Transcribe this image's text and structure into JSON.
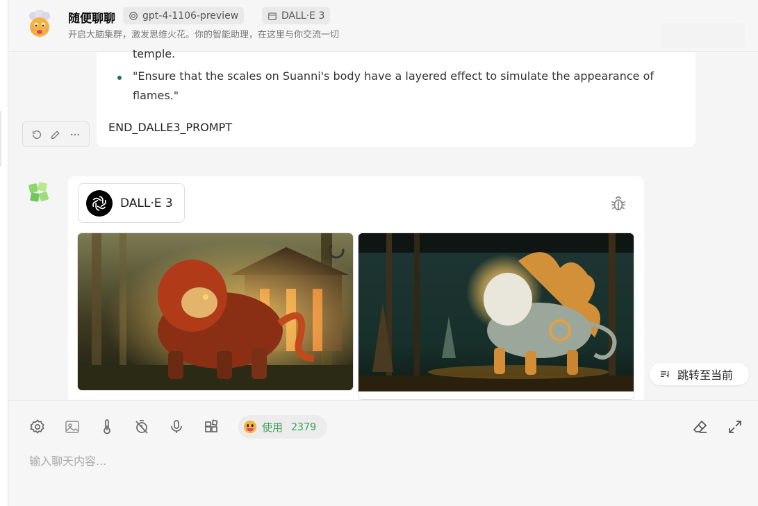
{
  "header": {
    "title": "随便聊聊",
    "model_chip": "gpt-4-1106-preview",
    "plugin_chip": "DALL·E 3",
    "description": "开启大脑集群，激发思维火花。你的智能助理，在这里与你交流一切"
  },
  "message1": {
    "cut_line": "temple.",
    "bullet_line1": "\"Ensure that the scales on Suanni's body have a layered effect to simulate the appearance of",
    "bullet_line2": "flames.\"",
    "end_text": "END_DALLE3_PROMPT"
  },
  "message2": {
    "plugin_name": "DALL·E 3",
    "images": [
      "qilin-temple-forest",
      "suanni-golden-flames"
    ]
  },
  "jump_button": "跳转至当前",
  "input": {
    "usage_label": "使用",
    "usage_count": "2379",
    "placeholder": "输入聊天内容..."
  },
  "colors": {
    "accent_green": "#3aa35a",
    "background": "#f5f5f5"
  }
}
